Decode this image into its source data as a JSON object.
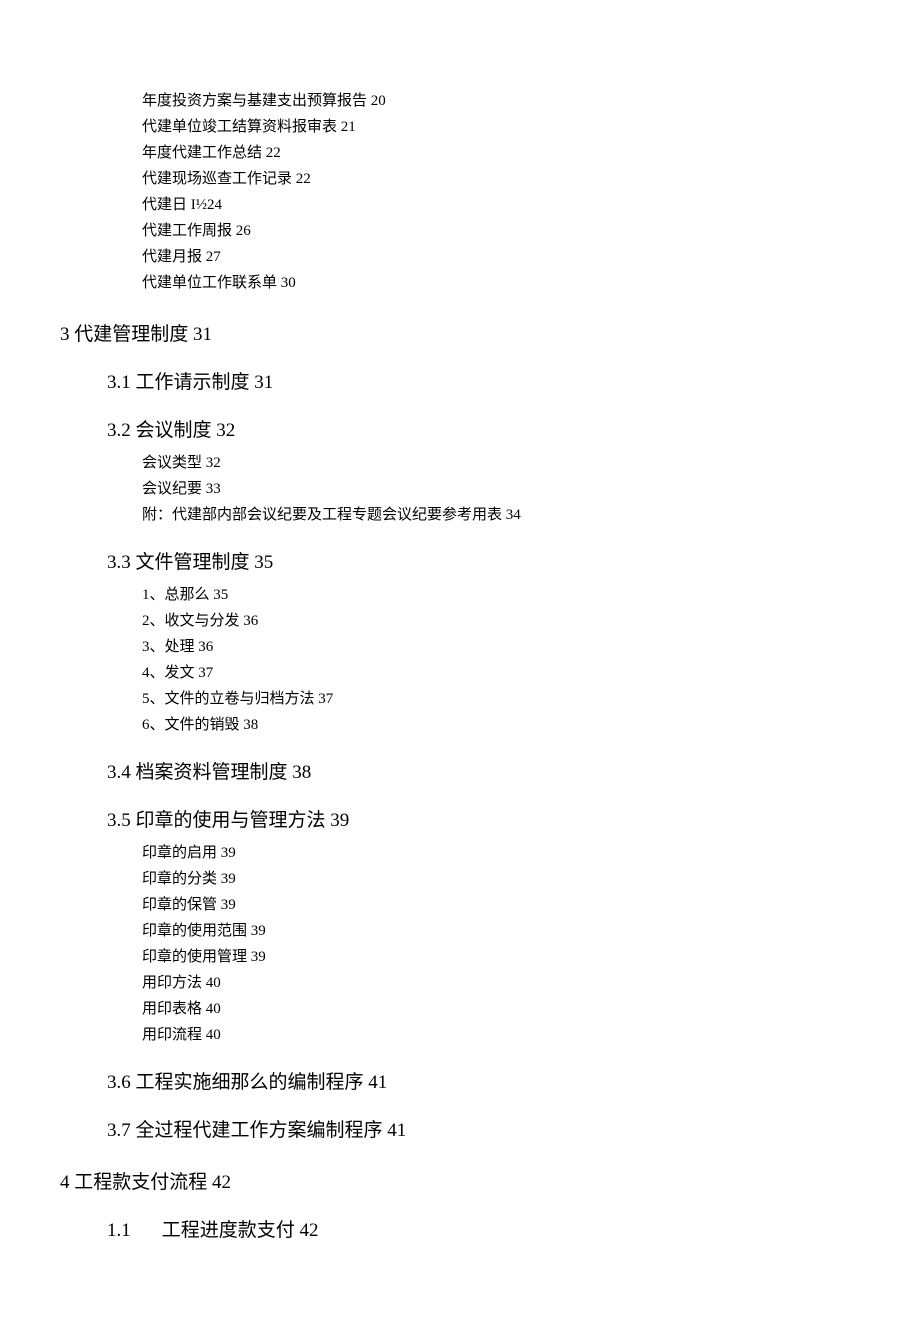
{
  "toc": {
    "preItems": [
      "年度投资方案与基建支出预算报告 20",
      "代建单位竣工结算资料报审表 21",
      "年度代建工作总结 22",
      "代建现场巡查工作记录 22",
      "代建日 I½24",
      "代建工作周报 26",
      "代建月报 27",
      "代建单位工作联系单 30"
    ],
    "s3": {
      "title": "3 代建管理制度 31",
      "s31": "3.1 工作请示制度 31",
      "s32": {
        "title": "3.2 会议制度 32",
        "items": [
          "会议类型 32",
          "会议纪要 33",
          "附：代建部内部会议纪要及工程专题会议纪要参考用表 34"
        ]
      },
      "s33": {
        "title": "3.3 文件管理制度 35",
        "items": [
          "1、总那么 35",
          "2、收文与分发 36",
          "3、处理 36",
          "4、发文 37",
          "5、文件的立卷与归档方法 37",
          "6、文件的销毁 38"
        ]
      },
      "s34": "3.4 档案资料管理制度 38",
      "s35": {
        "title": "3.5 印章的使用与管理方法 39",
        "items": [
          "印章的启用 39",
          "印章的分类 39",
          "印章的保管 39",
          "印章的使用范围 39",
          "印章的使用管理 39",
          "用印方法 40",
          "用印表格 40",
          "用印流程 40"
        ]
      },
      "s36": "3.6 工程实施细那么的编制程序 41",
      "s37": "3.7 全过程代建工作方案编制程序 41"
    },
    "s4": {
      "title": "4 工程款支付流程 42",
      "s11num": "1.1",
      "s11text": "工程进度款支付 42"
    }
  }
}
